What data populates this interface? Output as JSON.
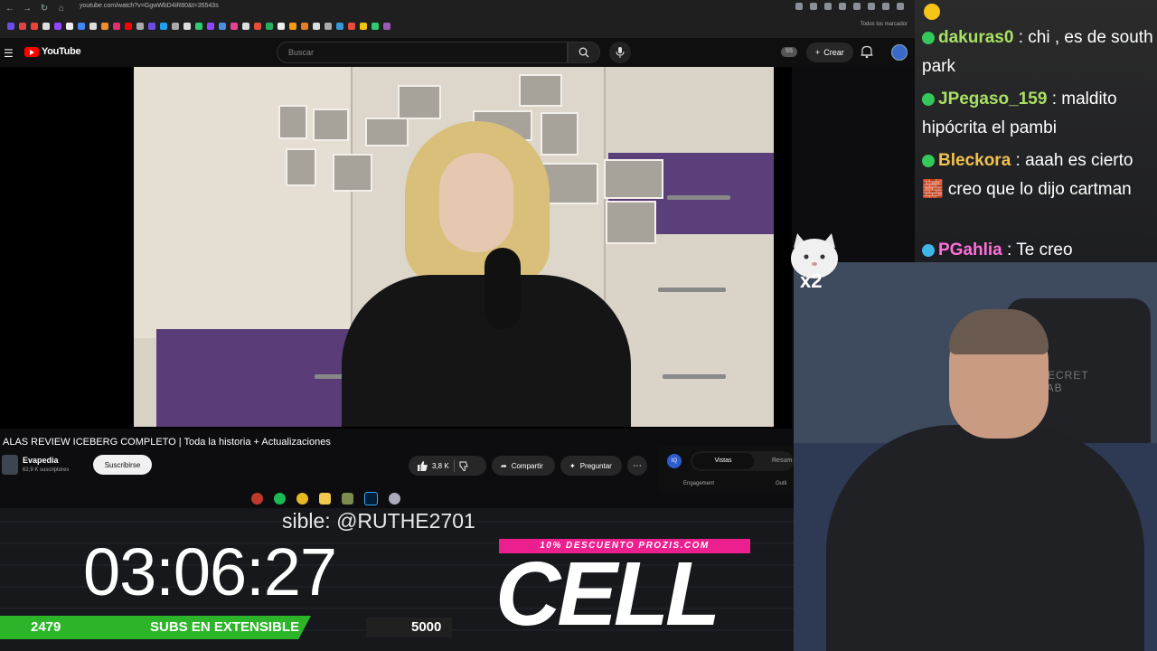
{
  "browser": {
    "url": "youtube.com/watch?v=GgwWbD4iR80&t=35543s",
    "bookmarks_all": "Todos los marcador"
  },
  "youtube": {
    "logo": "YouTube",
    "search_placeholder": "Buscar",
    "ss_badge": "SS",
    "create_label": "Crear"
  },
  "video": {
    "title": "ALAS REVIEW ICEBERG COMPLETO | Toda la historia + Actualizaciones",
    "channel": "Evapedia",
    "subscribers": "62,9 K suscriptores",
    "subscribe_label": "Suscribirse",
    "likes": "3,8 K",
    "share_label": "Compartir",
    "ask_label": "Preguntar"
  },
  "side_panel": {
    "tab_active": "Vistas",
    "tab_other": "Resum",
    "engagement": "Engagement",
    "outline": "Outli"
  },
  "overlay": {
    "marquee": "sible: @RUTHE2701",
    "timer": "03:06:27",
    "subs_current": "2479",
    "subs_label": "SUBS EN EXTENSIBLE",
    "subs_target": "5000",
    "subs_progress": 0.4958,
    "promo": "10% DESCUENTO PROZIS.COM",
    "sponsor": "CELL"
  },
  "chat": [
    {
      "user": "dakuras0",
      "color": "#a8e063",
      "text": " : chi , es de south park"
    },
    {
      "user": "JPegaso_159",
      "color": "#a8e063",
      "text": " : maldito hipócrita el pambi"
    },
    {
      "user": "Bleckora",
      "color": "#f2c14e",
      "text": " : aaah es cierto 🧱 creo que lo dijo cartman"
    },
    {
      "user": "PGahlia",
      "color": "#ff6fd8",
      "text": " : Te creo"
    }
  ],
  "emote": {
    "multiplier": "x2"
  },
  "colors": {
    "youtube_red": "#ff0000",
    "subs_green": "#2db52a",
    "promo_pink": "#ec1f8f"
  }
}
